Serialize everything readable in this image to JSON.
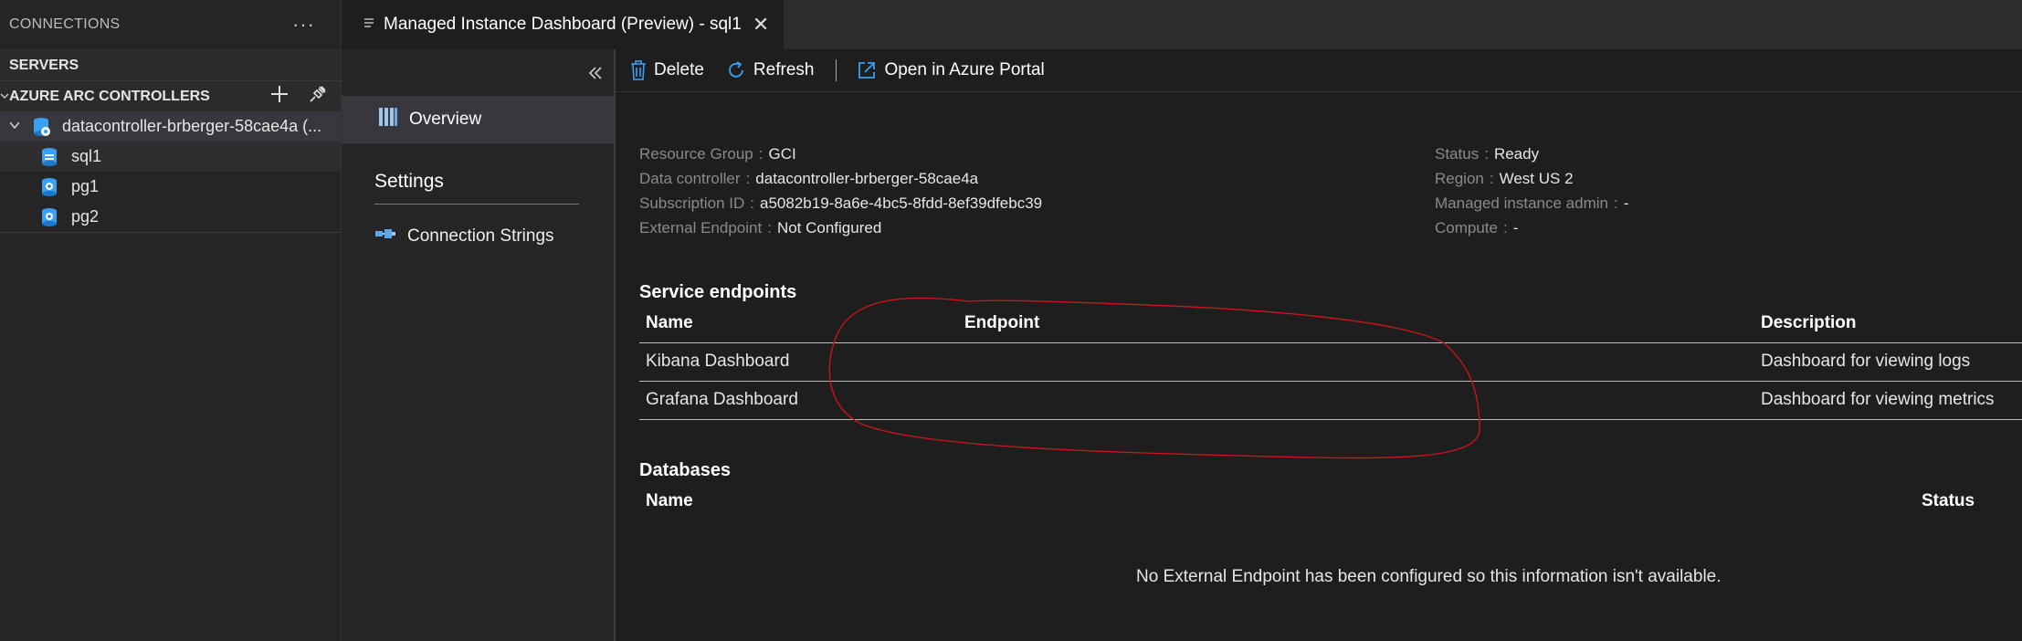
{
  "connections": {
    "header": "CONNECTIONS",
    "more": "···",
    "servers": "SERVERS",
    "arc_controllers": "AZURE ARC CONTROLLERS",
    "controller": "datacontroller-brberger-58cae4a (...",
    "items": [
      {
        "label": "sql1"
      },
      {
        "label": "pg1"
      },
      {
        "label": "pg2"
      }
    ]
  },
  "tab": {
    "title": "Managed Instance Dashboard (Preview) - sql1"
  },
  "nav": {
    "overview": "Overview",
    "settings": "Settings",
    "connection_strings": "Connection Strings"
  },
  "toolbar": {
    "delete": "Delete",
    "refresh": "Refresh",
    "open_portal": "Open in Azure Portal"
  },
  "properties": {
    "left": [
      {
        "key": "Resource Group",
        "value": "GCI"
      },
      {
        "key": "Data controller",
        "value": "datacontroller-brberger-58cae4a"
      },
      {
        "key": "Subscription ID",
        "value": "a5082b19-8a6e-4bc5-8fdd-8ef39dfebc39"
      },
      {
        "key": "External Endpoint",
        "value": "Not Configured"
      }
    ],
    "right": [
      {
        "key": "Status",
        "value": "Ready"
      },
      {
        "key": "Region",
        "value": "West US 2"
      },
      {
        "key": "Managed instance admin",
        "value": "-"
      },
      {
        "key": "Compute",
        "value": "-"
      }
    ]
  },
  "service_endpoints": {
    "title": "Service endpoints",
    "columns": {
      "name": "Name",
      "endpoint": "Endpoint",
      "description": "Description"
    },
    "rows": [
      {
        "name": "Kibana Dashboard",
        "endpoint": "",
        "description": "Dashboard for viewing logs"
      },
      {
        "name": "Grafana Dashboard",
        "endpoint": "",
        "description": "Dashboard for viewing metrics"
      }
    ]
  },
  "databases": {
    "title": "Databases",
    "columns": {
      "name": "Name",
      "status": "Status"
    },
    "empty_message": "No External Endpoint has been configured so this information isn't available."
  },
  "colors": {
    "annotation": "#c8141e",
    "icon_blue": "#3aa0f3"
  }
}
